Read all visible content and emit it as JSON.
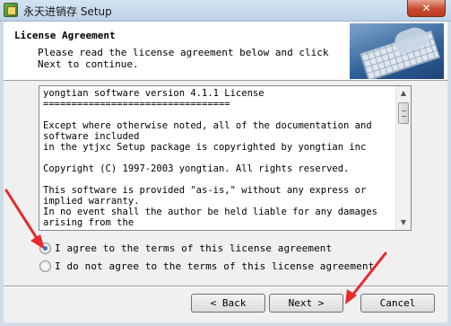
{
  "window": {
    "title": "永天进销存 Setup",
    "close_glyph": "✕"
  },
  "header": {
    "title": "License Agreement",
    "description": "Please read the license agreement below and click Next to continue."
  },
  "license": {
    "text": "yongtian software version 4.1.1 License\n=================================\n\nExcept where otherwise noted, all of the documentation and software included\nin the ytjxc Setup package is copyrighted by yongtian inc\n\nCopyright (C) 1997-2003 yongtian. All rights reserved.\n\nThis software is provided \"as-is,\" without any express or implied warranty.\nIn no event shall the author be held liable for any damages arising from the"
  },
  "options": {
    "agree_label": "I agree to the terms of this license agreement",
    "disagree_label": "I do not agree to the terms of this license agreement",
    "selected": "agree"
  },
  "buttons": {
    "back": "< Back",
    "next": "Next >",
    "cancel": "Cancel"
  },
  "colors": {
    "annotation_arrow": "#e8282b",
    "accent": "#2a7ed1"
  }
}
